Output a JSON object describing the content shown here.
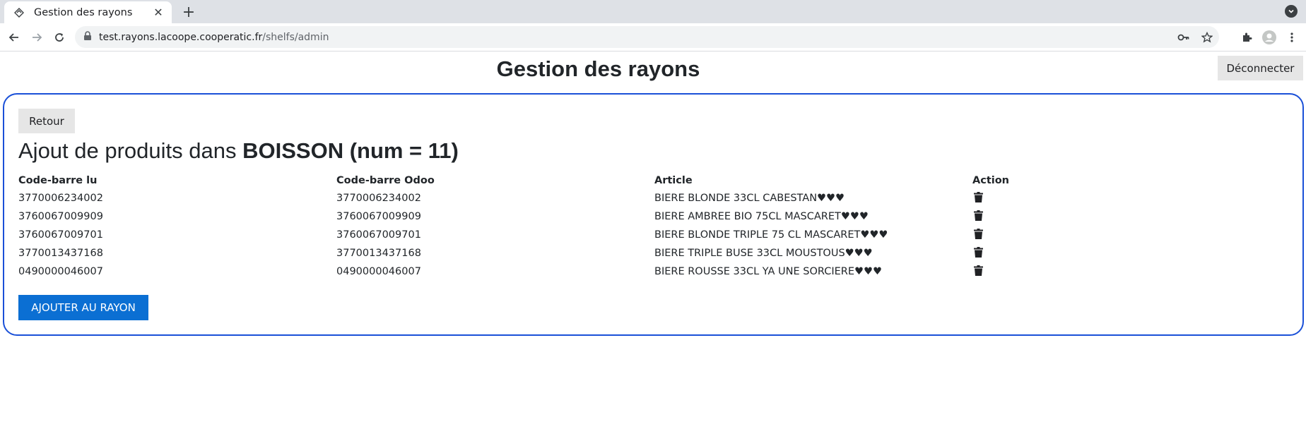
{
  "browser": {
    "tab_title": "Gestion des rayons",
    "url_host": "test.rayons.lacoope.cooperatic.fr",
    "url_path": "/shelfs/admin",
    "icons": [
      "tab-favicon-icon",
      "close-icon",
      "plus-icon",
      "tab-search-icon",
      "back-arrow-icon",
      "forward-arrow-icon",
      "reload-icon",
      "lock-icon",
      "key-icon",
      "star-icon",
      "extensions-icon",
      "profile-icon",
      "menu-icon"
    ]
  },
  "header": {
    "title": "Gestion des rayons",
    "logout_label": "Déconnecter"
  },
  "panel": {
    "back_label": "Retour",
    "title_prefix": "Ajout de produits dans ",
    "title_bold": "BOISSON (num = 11)",
    "border_color": "#1a50d8"
  },
  "table": {
    "columns": [
      "Code-barre lu",
      "Code-barre Odoo",
      "Article",
      "Action"
    ],
    "rows": [
      {
        "scanned": "3770006234002",
        "odoo": "3770006234002",
        "article": "BIERE BLONDE 33CL CABESTAN♥♥♥"
      },
      {
        "scanned": "3760067009909",
        "odoo": "3760067009909",
        "article": "BIERE AMBREE BIO 75CL MASCARET♥♥♥"
      },
      {
        "scanned": "3760067009701",
        "odoo": "3760067009701",
        "article": "BIERE BLONDE TRIPLE 75 CL MASCARET♥♥♥"
      },
      {
        "scanned": "3770013437168",
        "odoo": "3770013437168",
        "article": "BIERE TRIPLE BUSE 33CL MOUSTOUS♥♥♥"
      },
      {
        "scanned": "0490000046007",
        "odoo": "0490000046007",
        "article": "BIERE ROUSSE 33CL YA UNE SORCIERE♥♥♥"
      }
    ],
    "action_icon": "trash-icon"
  },
  "actions": {
    "add_label": "AJOUTER AU RAYON",
    "add_color": "#0b6fd3"
  }
}
